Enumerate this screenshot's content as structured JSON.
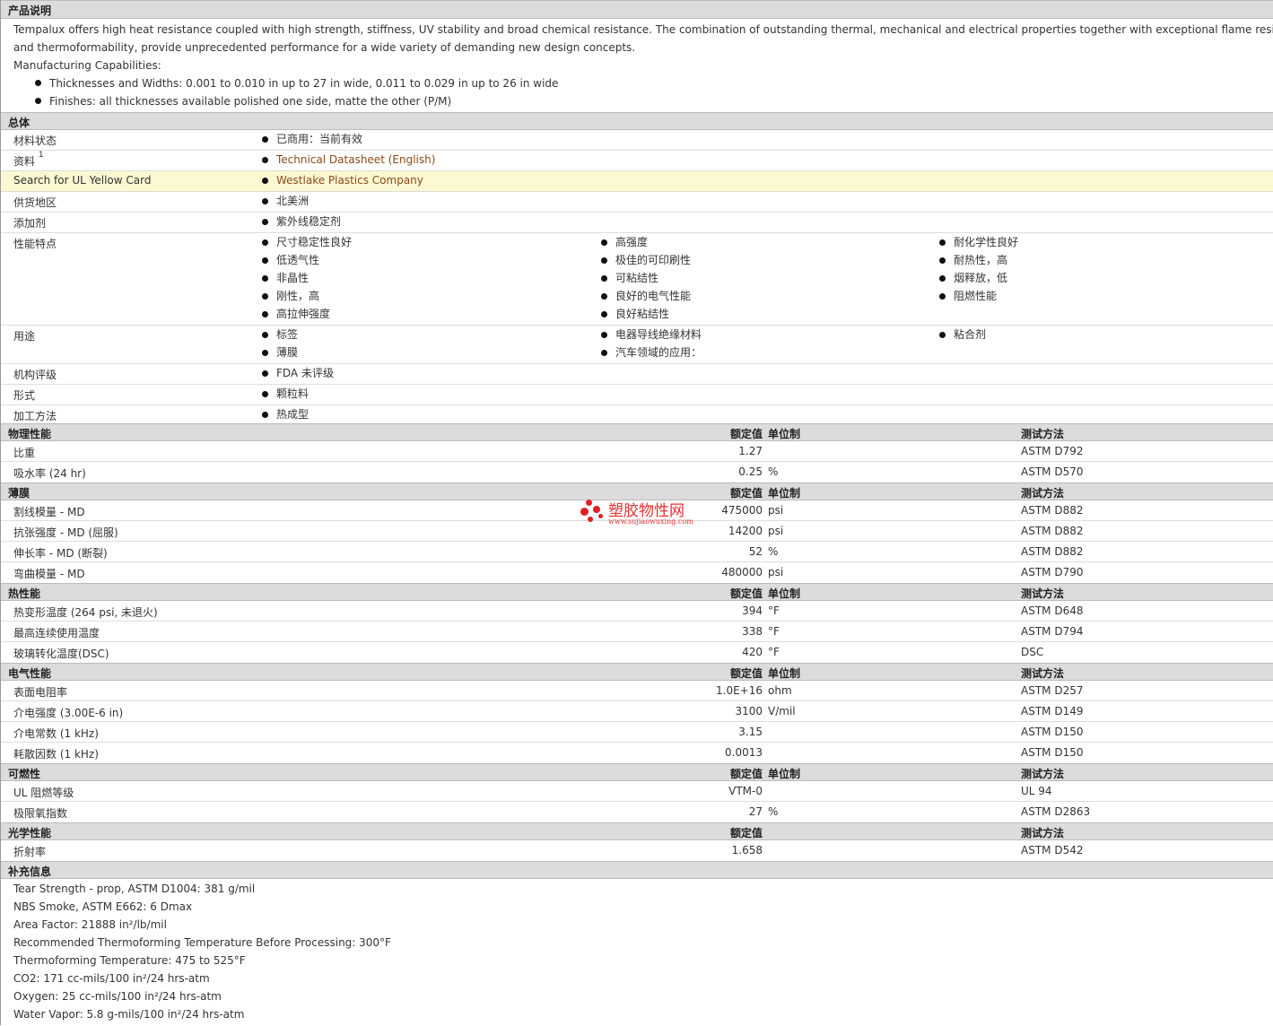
{
  "desc": {
    "title": "产品说明",
    "para1": "Tempalux offers high heat resistance coupled with high strength, stiffness, UV stability and broad chemical resistance. The combination of outstanding thermal, mechanical and electrical properties together with exceptional flame resistance",
    "para2": "and thermoformability, provide unprecedented performance for a wide variety of demanding new design concepts.",
    "cap": "Manufacturing Capabilities:",
    "b1": "Thicknesses and Widths: 0.001 to 0.010 in up to 27 in wide, 0.011 to 0.029 in up to 26 in wide",
    "b2": "Finishes: all thicknesses available polished one side, matte the other (P/M)"
  },
  "general": {
    "title": "总体",
    "status_label": "材料状态",
    "status_val": "已商用：当前有效",
    "docs_label": "资料",
    "docs_sup": "1",
    "docs_val": "Technical Datasheet (English)",
    "ul_label": "Search for UL Yellow Card",
    "ul_val": "Westlake Plastics Company",
    "region_label": "供货地区",
    "region_val": "北美洲",
    "additive_label": "添加剂",
    "additive_val": "紫外线稳定剂",
    "features_label": "性能特点",
    "features_c1": [
      "尺寸稳定性良好",
      "低透气性",
      "非晶性",
      "刚性，高",
      "高拉伸强度"
    ],
    "features_c2": [
      "高强度",
      "极佳的可印刷性",
      "可粘结性",
      "良好的电气性能",
      "良好粘结性"
    ],
    "features_c3": [
      "耐化学性良好",
      "耐热性，高",
      "烟释放，低",
      "阻燃性能"
    ],
    "uses_label": "用途",
    "uses_c1": [
      "标签",
      "薄膜"
    ],
    "uses_c2": [
      "电器导线绝缘材料",
      "汽车领域的应用："
    ],
    "uses_c3": [
      "粘合剂"
    ],
    "agency_label": "机构评级",
    "agency_val": "FDA 未评级",
    "form_label": "形式",
    "form_val": "颗粒料",
    "process_label": "加工方法",
    "process_val": "热成型"
  },
  "headers": {
    "nominal": "额定值",
    "unit": "单位制",
    "test": "测试方法"
  },
  "physical": {
    "title": "物理性能",
    "rows": [
      {
        "label": "比重",
        "value": "1.27",
        "unit": "",
        "test": "ASTM D792"
      },
      {
        "label": "吸水率  (24 hr)",
        "value": "0.25",
        "unit": "%",
        "test": "ASTM D570"
      }
    ]
  },
  "film": {
    "title": "薄膜",
    "rows": [
      {
        "label": "割线模量  - MD",
        "value": "475000",
        "unit": "psi",
        "test": "ASTM D882"
      },
      {
        "label": "抗张强度  - MD (屈服)",
        "value": "14200",
        "unit": "psi",
        "test": "ASTM D882"
      },
      {
        "label": "伸长率  - MD (断裂)",
        "value": "52",
        "unit": "%",
        "test": "ASTM D882"
      },
      {
        "label": "弯曲模量  - MD",
        "value": "480000",
        "unit": "psi",
        "test": "ASTM D790"
      }
    ]
  },
  "thermal": {
    "title": "热性能",
    "rows": [
      {
        "label": "热变形温度  (264 psi, 未退火)",
        "value": "394",
        "unit": "°F",
        "test": "ASTM D648"
      },
      {
        "label": "最高连续使用温度",
        "value": "338",
        "unit": "°F",
        "test": "ASTM D794"
      },
      {
        "label": "玻璃转化温度(DSC)",
        "value": "420",
        "unit": "°F",
        "test": "DSC"
      }
    ]
  },
  "electrical": {
    "title": "电气性能",
    "rows": [
      {
        "label": "表面电阻率",
        "value": "1.0E+16",
        "unit": "ohm",
        "test": "ASTM D257"
      },
      {
        "label": "介电强度  (3.00E-6 in)",
        "value": "3100",
        "unit": "V/mil",
        "test": "ASTM D149"
      },
      {
        "label": "介电常数  (1 kHz)",
        "value": "3.15",
        "unit": "",
        "test": "ASTM D150"
      },
      {
        "label": "耗散因数  (1 kHz)",
        "value": "0.0013",
        "unit": "",
        "test": "ASTM D150"
      }
    ]
  },
  "flammability": {
    "title": "可燃性",
    "rows": [
      {
        "label": "UL 阻燃等级",
        "value": "VTM-0",
        "unit": "",
        "test": "UL 94"
      },
      {
        "label": "极限氧指数",
        "value": "27",
        "unit": "%",
        "test": "ASTM D2863"
      }
    ]
  },
  "optical": {
    "title": "光学性能",
    "rows": [
      {
        "label": "折射率",
        "value": "1.658",
        "unit": "",
        "test": "ASTM D542"
      }
    ]
  },
  "supplement": {
    "title": "补充信息",
    "lines": [
      "Tear Strength - prop, ASTM D1004: 381 g/mil",
      "NBS Smoke, ASTM E662: 6 Dmax",
      "Area Factor: 21888 in²/lb/mil",
      "Recommended Thermoforming Temperature Before Processing: 300°F",
      "Thermoforming Temperature: 475 to 525°F",
      "CO2: 171 cc-mils/100 in²/24 hrs-atm",
      "Oxygen: 25 cc-mils/100 in²/24 hrs-atm",
      "Water Vapor: 5.8 g-mils/100 in²/24 hrs-atm"
    ]
  },
  "watermark": {
    "cn": "塑胶物性网",
    "url": "www.sujiaowuxing.com"
  },
  "colors": {
    "section_bg": "#dcdcdc",
    "highlight": "#fcf8d2",
    "link": "#8a4a1a",
    "watermark": "#e02020"
  }
}
